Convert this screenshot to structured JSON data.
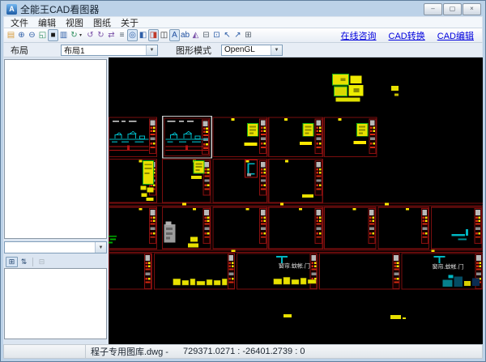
{
  "window": {
    "title": "全能王CAD看图器",
    "icon_glyph": "A",
    "controls": [
      {
        "name": "minimize-button",
        "glyph": "–"
      },
      {
        "name": "maximize-button",
        "glyph": "▢"
      },
      {
        "name": "close-button",
        "glyph": "×"
      }
    ]
  },
  "menu": {
    "items": [
      {
        "name": "menu-file",
        "label": "文件"
      },
      {
        "name": "menu-edit",
        "label": "编辑"
      },
      {
        "name": "menu-view",
        "label": "视图"
      },
      {
        "name": "menu-drawing",
        "label": "图纸"
      },
      {
        "name": "menu-about",
        "label": "关于"
      }
    ]
  },
  "toolbar": {
    "icons": [
      {
        "name": "open-file-icon",
        "glyph": "▤",
        "color": "#d79b3c"
      },
      {
        "name": "zoom-in-icon",
        "glyph": "⊕",
        "color": "#2f5fa8"
      },
      {
        "name": "zoom-out-icon",
        "glyph": "⊖",
        "color": "#2f5fa8"
      },
      {
        "name": "fit-window-icon",
        "glyph": "◱",
        "color": "#2f8f5f"
      },
      {
        "name": "background-toggle-icon",
        "glyph": "■",
        "color": "#1a1a1a",
        "pressed": true
      },
      {
        "name": "full-view-icon",
        "glyph": "▥",
        "color": "#2f5fa8"
      },
      {
        "name": "rotate-view-icon",
        "glyph": "↻",
        "color": "#2f8f5f",
        "dropdown": true
      },
      {
        "name": "rotate-left-icon",
        "glyph": "↺",
        "color": "#7b52a8"
      },
      {
        "name": "rotate-right-icon",
        "glyph": "↻",
        "color": "#7b52a8"
      },
      {
        "name": "refresh-icon",
        "glyph": "⇄",
        "color": "#7b52a8"
      },
      {
        "name": "layers-icon",
        "glyph": "≡",
        "color": "#4a5a68"
      },
      {
        "name": "lineweight-toggle-icon",
        "glyph": "◎",
        "color": "#2f5fa8",
        "pressed": true
      },
      {
        "name": "split-view-icon",
        "glyph": "◧",
        "color": "#2f5fa8"
      },
      {
        "name": "color-mode-icon",
        "glyph": "◨",
        "color": "#c03a2b",
        "pressed": true
      },
      {
        "name": "invert-colors-icon",
        "glyph": "◫",
        "color": "#2a2a2a"
      },
      {
        "name": "text-toggle-icon",
        "glyph": "A",
        "color": "#1f4fa0",
        "pressed": true
      },
      {
        "name": "annotation-icon",
        "glyph": "ab",
        "color": "#1f4fa0"
      },
      {
        "name": "blocks-icon",
        "glyph": "◭",
        "color": "#7b52a8"
      },
      {
        "name": "print-icon",
        "glyph": "⊟",
        "color": "#55606c"
      },
      {
        "name": "measure-area-icon",
        "glyph": "⊡",
        "color": "#2f5fa8"
      },
      {
        "name": "select-icon",
        "glyph": "↖",
        "color": "#2f5fa8"
      },
      {
        "name": "measure-distance-icon",
        "glyph": "↗",
        "color": "#2f5fa8"
      },
      {
        "name": "copy-icon",
        "glyph": "⊞",
        "color": "#55606c"
      }
    ],
    "links": [
      {
        "name": "online-consult-link",
        "label": "在线咨询"
      },
      {
        "name": "cad-convert-link",
        "label": "CAD转换"
      },
      {
        "name": "cad-edit-link",
        "label": "CAD编辑"
      }
    ]
  },
  "options_bar": {
    "layout_label": "布局",
    "layout_value": "布局1",
    "mode_label": "图形模式",
    "mode_value": "OpenGL"
  },
  "sidebar": {
    "object_combo_value": "",
    "property_toolbar": [
      {
        "name": "categorized-view-icon",
        "glyph": "⊞",
        "state": "active"
      },
      {
        "name": "alphabetical-sort-icon",
        "glyph": "⇅",
        "state": "normal"
      },
      {
        "name": "property-pages-icon",
        "glyph": "⊟",
        "state": "disabled",
        "separator_before": true
      }
    ]
  },
  "canvas": {
    "background": "#000000",
    "frame_color": "#7a0e0e",
    "accent_yellow": "#e8e000",
    "accent_cyan": "#00b7c3",
    "selection_color": "#c8c8c8",
    "sheet_labels": [
      "窗帘.蚊帐.门",
      "窗帘.蚊帐.门"
    ]
  },
  "statusbar": {
    "filename": "程子专用图库.dwg -",
    "coordinates": "729371.0271 : -26401.2739 : 0"
  }
}
